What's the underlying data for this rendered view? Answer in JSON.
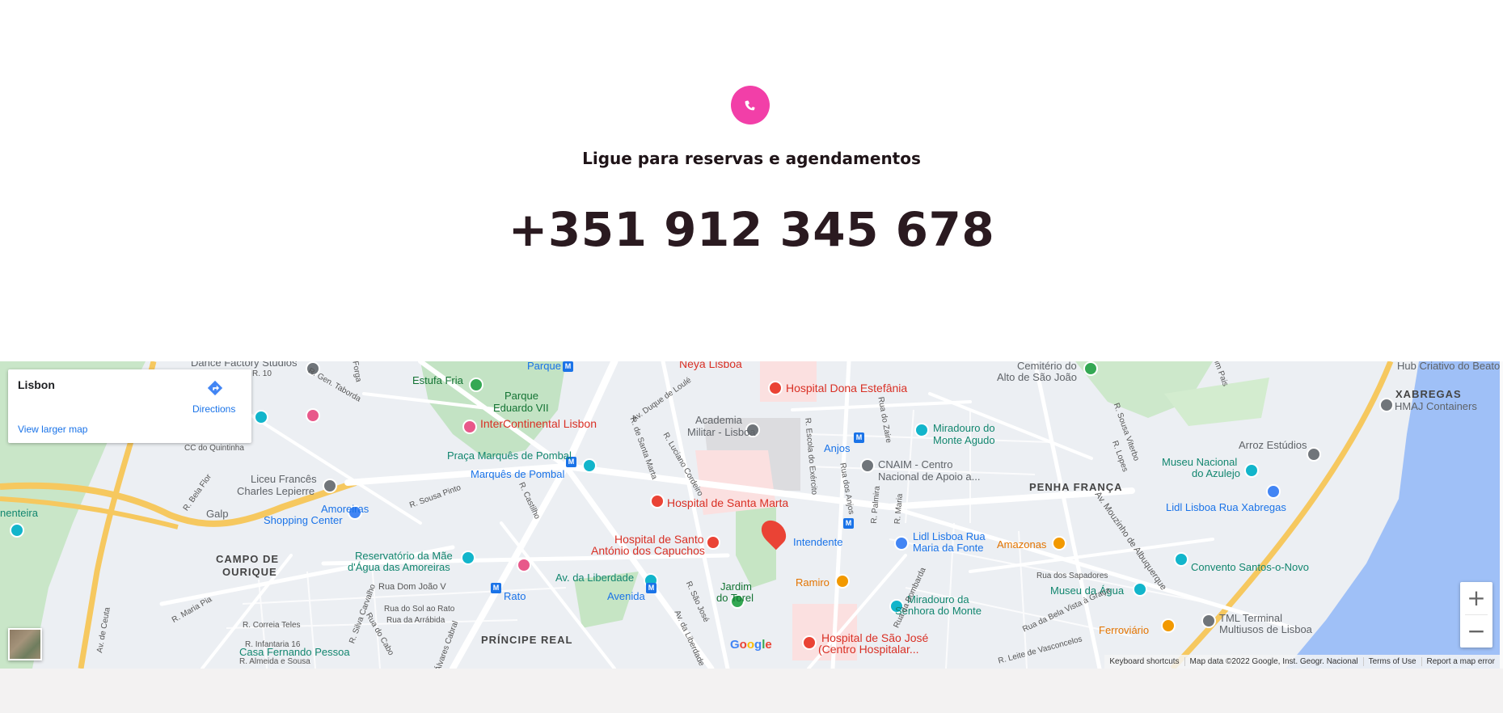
{
  "contact": {
    "heading": "Ligue para reservas e agendamentos",
    "phone": "+351 912 345 678",
    "icon": "phone-icon",
    "accent": "#f23fa8"
  },
  "map": {
    "place_title": "Lisbon",
    "directions_label": "Directions",
    "larger_map_label": "View larger map",
    "zoom_in_label": "+",
    "zoom_out_label": "−",
    "google_logo": "Google",
    "attribution": {
      "shortcuts": "Keyboard shortcuts",
      "data": "Map data ©2022 Google, Inst. Geogr. Nacional",
      "terms": "Terms of Use",
      "report": "Report a map error"
    },
    "labels": [
      {
        "text": "Dance Factory Studios",
        "cls": "poi-gray"
      },
      {
        "text": "Estufa Fria",
        "cls": "poi-green"
      },
      {
        "text": "Parque",
        "cls": "poi-blue"
      },
      {
        "text": "Neya Lisboa",
        "cls": "poi-red"
      },
      {
        "text": "Hospital Dona Estefânia",
        "cls": "poi-red"
      },
      {
        "text": "Cemitério do",
        "cls": "poi-gray"
      },
      {
        "text": "Alto de São João",
        "cls": "poi-gray"
      },
      {
        "text": "Hub Criativo do Beato",
        "cls": "poi-gray"
      },
      {
        "text": "XABREGAS",
        "cls": "area"
      },
      {
        "text": "HMAJ Containers",
        "cls": "poi-gray"
      },
      {
        "text": "Parque",
        "cls": "poi-green"
      },
      {
        "text": "Eduardo VII",
        "cls": "poi-green"
      },
      {
        "text": "InterContinental Lisbon",
        "cls": "poi-red"
      },
      {
        "text": "Academia",
        "cls": "poi-gray"
      },
      {
        "text": "Militar - Lisboa",
        "cls": "poi-gray"
      },
      {
        "text": "Miradouro do",
        "cls": "poi-teal"
      },
      {
        "text": "Monte Agudo",
        "cls": "poi-teal"
      },
      {
        "text": "Arroz Estúdios",
        "cls": "poi-gray"
      },
      {
        "text": "Praça Marquês de Pombal",
        "cls": "poi-teal"
      },
      {
        "text": "Anjos",
        "cls": "poi-blue"
      },
      {
        "text": "CNAIM - Centro",
        "cls": "poi-gray"
      },
      {
        "text": "Nacional de Apoio a...",
        "cls": "poi-gray"
      },
      {
        "text": "Museu Nacional",
        "cls": "poi-teal"
      },
      {
        "text": "do Azulejo",
        "cls": "poi-teal"
      },
      {
        "text": "Marquês de Pombal",
        "cls": "poi-blue"
      },
      {
        "text": "Liceu Francês",
        "cls": "poi-gray"
      },
      {
        "text": "Charles Lepierre",
        "cls": "poi-gray"
      },
      {
        "text": "PENHA FRANÇA",
        "cls": "area"
      },
      {
        "text": "Lidl Lisboa Rua Xabregas",
        "cls": "poi-blue"
      },
      {
        "text": "Hospital de Santa Marta",
        "cls": "poi-red"
      },
      {
        "text": "Amoreiras",
        "cls": "poi-blue"
      },
      {
        "text": "Shopping Center",
        "cls": "poi-blue"
      },
      {
        "text": "Galp",
        "cls": "poi-gray"
      },
      {
        "text": "nenteira",
        "cls": "poi-teal"
      },
      {
        "text": "Hospital de Santo",
        "cls": "poi-red"
      },
      {
        "text": "António dos Capuchos",
        "cls": "poi-red"
      },
      {
        "text": "Intendente",
        "cls": "poi-blue"
      },
      {
        "text": "Lidl Lisboa Rua",
        "cls": "poi-blue"
      },
      {
        "text": "Maria da Fonte",
        "cls": "poi-blue"
      },
      {
        "text": "Amazonas",
        "cls": "poi-orange"
      },
      {
        "text": "Reservatório da Mãe",
        "cls": "poi-teal"
      },
      {
        "text": "d'Água das Amoreiras",
        "cls": "poi-teal"
      },
      {
        "text": "CAMPO DE",
        "cls": "area"
      },
      {
        "text": "OURIQUE",
        "cls": "area"
      },
      {
        "text": "Av. da Liberdade",
        "cls": "poi-teal"
      },
      {
        "text": "Ramiro",
        "cls": "poi-orange"
      },
      {
        "text": "Convento Santos-o-Novo",
        "cls": "poi-teal"
      },
      {
        "text": "Museu da Água",
        "cls": "poi-teal"
      },
      {
        "text": "Jardim",
        "cls": "poi-green"
      },
      {
        "text": "do Torel",
        "cls": "poi-green"
      },
      {
        "text": "Rato",
        "cls": "poi-blue"
      },
      {
        "text": "Avenida",
        "cls": "poi-blue"
      },
      {
        "text": "Miradouro da",
        "cls": "poi-teal"
      },
      {
        "text": "Senhora do Monte",
        "cls": "poi-teal"
      },
      {
        "text": "Ferroviário",
        "cls": "poi-orange"
      },
      {
        "text": "TML Terminal",
        "cls": "poi-gray"
      },
      {
        "text": "Multiusos de Lisboa",
        "cls": "poi-gray"
      },
      {
        "text": "PRÍNCIPE REAL",
        "cls": "area"
      },
      {
        "text": "Hospital de São José",
        "cls": "poi-red"
      },
      {
        "text": "(Centro Hospitalar...",
        "cls": "poi-red"
      },
      {
        "text": "Casa Fernando Pessoa",
        "cls": "poi-teal"
      }
    ],
    "streets": [
      "Rua Dom João V",
      "R. Maria Pia",
      "Av. de Ceuta",
      "R. Correia Teles",
      "R. Infantaria 16",
      "R. Almeida e Sousa",
      "Rua do Sol ao Rato",
      "Rua da Arrábida",
      "Rua do Cabo",
      "R. Silva Carvalho",
      "Álvares Cabral",
      "Av. da Liberdade",
      "R. São José",
      "Rua da Bombarda",
      "Rua dos Sapadores",
      "Rua da Bela Vista à Graça",
      "R. Leite de Vasconcelos",
      "Av. Mouzinho de Albuquerque",
      "R. Sousa Viterbo",
      "R. Lopes",
      "Rua do Zaire",
      "Rua dos Anjos",
      "R. Palmira",
      "R. Maria",
      "R. Escola do Exército",
      "R. Luciano Cordeiro",
      "Av. Duque de Loulé",
      "R. de Santa Marta",
      "R. Castilho",
      "R. Sousa Pinto",
      "R. Gen. Taborda",
      "R. 10",
      "R. Bela Flor",
      "CC do Quintinha",
      "Forga",
      "dim Pais"
    ]
  }
}
